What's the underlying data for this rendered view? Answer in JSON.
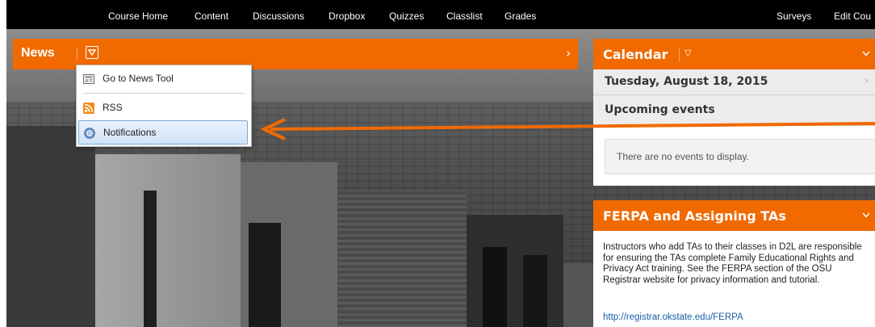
{
  "nav": {
    "items": [
      "Course Home",
      "Content",
      "Discussions",
      "Dropbox",
      "Quizzes",
      "Classlist",
      "Grades"
    ],
    "right_items": [
      "Surveys",
      "Edit Cou"
    ]
  },
  "news": {
    "title": "News",
    "chevron": "›",
    "menu": [
      {
        "label": "Go to News Tool",
        "icon": "news-tool-icon"
      },
      {
        "label": "RSS",
        "icon": "rss-icon"
      },
      {
        "label": "Notifications",
        "icon": "notifications-icon"
      }
    ]
  },
  "calendar": {
    "title": "Calendar",
    "dd": "▽",
    "date": "Tuesday, August 18, 2015",
    "upcoming": "Upcoming events",
    "empty": "There are no events to display."
  },
  "ferpa": {
    "title": "FERPA and Assigning TAs",
    "text": "Instructors who add TAs to their classes in D2L are responsible for ensuring the TAs complete Family Educational Rights and Privacy Act training. See the FERPA section of the OSU Registrar website for privacy information and tutorial.",
    "link": "http://registrar.okstate.edu/FERPA"
  },
  "colors": {
    "accent": "#f06a00",
    "nav_bg": "#000000",
    "link": "#1a5ea8",
    "arrow": "#f06a00"
  }
}
